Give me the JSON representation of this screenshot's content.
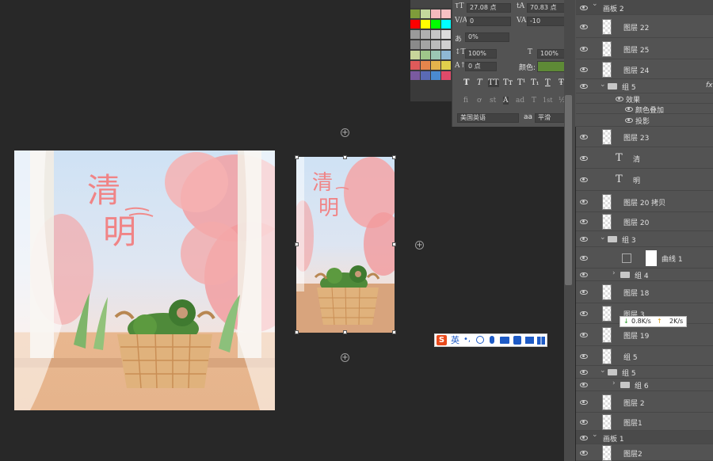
{
  "canvas": {
    "large_artboard": {
      "title_char1": "清",
      "title_char2": "明"
    },
    "small_artboard": {
      "title_char1": "清",
      "title_char2": "明"
    }
  },
  "ime_toolbar": {
    "logo": "S",
    "mode": "英",
    "icons": [
      "punct-icon",
      "emoji-icon",
      "mic-icon",
      "keyboard-icon",
      "toolbox-icon",
      "skin-icon",
      "grid-icon"
    ]
  },
  "net_speed": {
    "down": "0.8K/s",
    "up": "2K/s"
  },
  "character": {
    "font_size": "27.08 点",
    "leading": "70.83 点",
    "kerning": "0",
    "tracking": "-10",
    "scale_percent": "0%",
    "vertical_scale": "100%",
    "horizontal_scale": "100%",
    "baseline_shift": "0 点",
    "color_label": "颜色:",
    "color_value": "#5e8a36",
    "style_buttons": [
      "T",
      "T",
      "TT",
      "Tт",
      "T¹",
      "T₁",
      "T",
      "Ŧ"
    ],
    "opentype_buttons": [
      "fi",
      "ơ",
      "st",
      "A",
      "ad",
      "T",
      "1st",
      "½"
    ],
    "language": "美国英语",
    "aa_label": "aa",
    "antialias": "平滑"
  },
  "layers": {
    "items": [
      {
        "type": "artboard",
        "name": "画板 2"
      },
      {
        "type": "layer",
        "name": "图层 22"
      },
      {
        "type": "layer",
        "name": "图层 25"
      },
      {
        "type": "layer",
        "name": "图层 24"
      },
      {
        "type": "group",
        "name": "组 5",
        "fx": "fx"
      },
      {
        "type": "effect",
        "name": "效果"
      },
      {
        "type": "effect-item",
        "name": "颜色叠加"
      },
      {
        "type": "effect-item",
        "name": "投影"
      },
      {
        "type": "layer",
        "name": "图层 23"
      },
      {
        "type": "text",
        "name": "清"
      },
      {
        "type": "text",
        "name": "明"
      },
      {
        "type": "layer",
        "name": "图层 20 拷贝"
      },
      {
        "type": "layer",
        "name": "图层 20"
      },
      {
        "type": "group",
        "name": "组 3"
      },
      {
        "type": "adjust",
        "name": "曲线 1"
      },
      {
        "type": "subgroup",
        "name": "组 4"
      },
      {
        "type": "layer",
        "name": "图层 18"
      },
      {
        "type": "layer",
        "name": "图层 3"
      },
      {
        "type": "layer",
        "name": "图层 19"
      },
      {
        "type": "layer",
        "name": "组 5"
      },
      {
        "type": "group",
        "name": "组 5"
      },
      {
        "type": "subgroup",
        "name": "组 6"
      },
      {
        "type": "layer",
        "name": "图层 2"
      },
      {
        "type": "layer",
        "name": "图层1"
      },
      {
        "type": "artboard",
        "name": "画板 1"
      },
      {
        "type": "layer",
        "name": "图层2"
      }
    ]
  }
}
